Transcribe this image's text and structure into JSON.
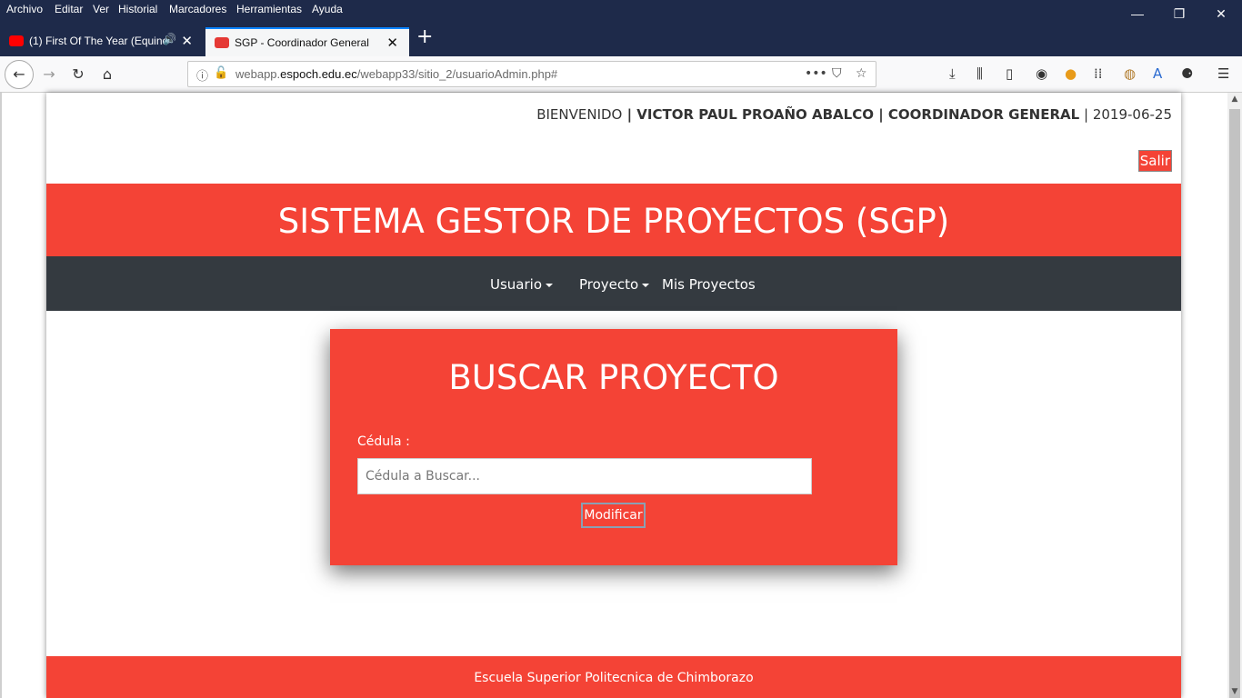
{
  "browser": {
    "menu": [
      "Archivo",
      "Editar",
      "Ver",
      "Historial",
      "Marcadores",
      "Herramientas",
      "Ayuda"
    ],
    "window_controls": {
      "minimize": "—",
      "restore": "❐",
      "close": "✕"
    },
    "tabs": [
      {
        "title": "(1) First Of The Year (Equino",
        "favicon_color": "#ff0000"
      },
      {
        "title": "SGP - Coordinador General",
        "favicon_color": "#e53935"
      }
    ],
    "url_prefix": "webapp.",
    "url_domain": "espoch.edu.ec",
    "url_path": "/webapp33/sitio_2/usuarioAdmin.php#"
  },
  "header": {
    "welcome": "BIENVENIDO",
    "separator": " | ",
    "user_name": "VICTOR PAUL PROAÑO ABALCO | COORDINADOR GENERAL",
    "date": "2019-06-25",
    "logout_label": "Salir"
  },
  "banner": {
    "title": "SISTEMA GESTOR DE PROYECTOS (SGP)"
  },
  "nav": {
    "usuario": "Usuario",
    "proyecto": "Proyecto",
    "mis_proyectos": "Mis Proyectos"
  },
  "search": {
    "title": "BUSCAR PROYECTO",
    "label": "Cédula :",
    "placeholder": "Cédula a Buscar...",
    "button": "Modificar"
  },
  "footer": {
    "text": "Escuela Superior Politecnica de Chimborazo"
  },
  "colors": {
    "primary": "#f44336",
    "nav": "#343a40",
    "browser_chrome": "#1e2a4a"
  }
}
